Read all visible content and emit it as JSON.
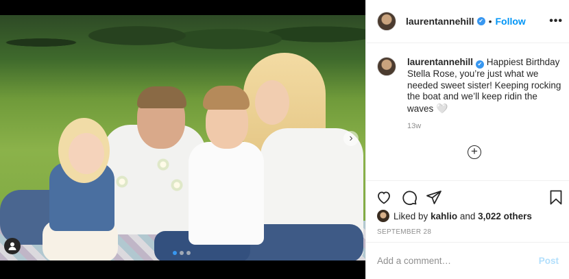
{
  "post": {
    "username": "laurentannehill",
    "follow_label": "Follow",
    "separator": "•",
    "more_label": "•••",
    "verified_mark": "✔",
    "caption": "Happiest Birthday Stella Rose, you’re just what we needed sweet sister! Keeping rocking the boat and we’ll keep ridin the waves",
    "caption_emoji": "🤍",
    "time_ago": "13w",
    "load_more_symbol": "+",
    "likes": {
      "prefix": "Liked by",
      "liked_by_user": "kahlio",
      "joiner": "and",
      "others_count": "3,022 others"
    },
    "date": "SEPTEMBER 28",
    "comment_placeholder": "Add a comment…",
    "post_button": "Post",
    "carousel": {
      "total": 3,
      "active_index": 0
    },
    "icons": [
      "heart-icon",
      "comment-icon",
      "share-icon",
      "bookmark-icon",
      "add-comment-icon",
      "user-tag-icon",
      "next-arrow-icon",
      "more-options-icon",
      "verified-icon"
    ]
  },
  "colors": {
    "accent": "#0095f6",
    "verified": "#3897f0",
    "muted": "#8e8e8e",
    "post_disabled": "#b2dffc",
    "text": "#262626",
    "border": "#efefef"
  }
}
